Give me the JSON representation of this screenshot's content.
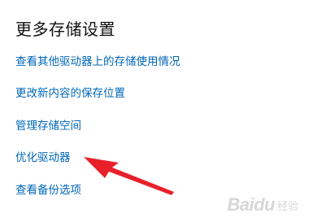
{
  "section": {
    "title": "更多存储设置"
  },
  "links": [
    {
      "label": "查看其他驱动器上的存储使用情况"
    },
    {
      "label": "更改新内容的保存位置"
    },
    {
      "label": "管理存储空间"
    },
    {
      "label": "优化驱动器"
    },
    {
      "label": "查看备份选项"
    }
  ],
  "annotation": {
    "arrow_color": "#e8202a",
    "points_to": "优化驱动器"
  },
  "watermark": {
    "brand": "Baidu",
    "sub": "经验"
  },
  "colors": {
    "link": "#0067b8",
    "title": "#111111",
    "background": "#ffffff"
  }
}
